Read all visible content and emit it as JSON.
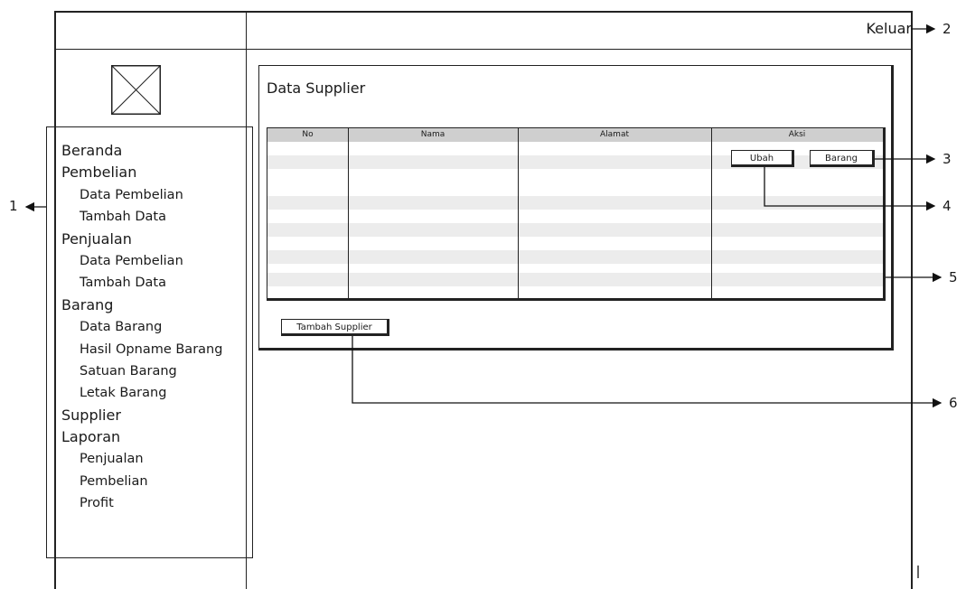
{
  "header": {
    "logout_label": "Keluar"
  },
  "sidebar": {
    "logo_icon": "image-placeholder-icon",
    "items": [
      {
        "label": "Beranda",
        "level": "top"
      },
      {
        "label": "Pembelian",
        "level": "top"
      },
      {
        "label": "Data Pembelian",
        "level": "sub"
      },
      {
        "label": "Tambah Data",
        "level": "sub"
      },
      {
        "label": "Penjualan",
        "level": "top"
      },
      {
        "label": "Data Pembelian",
        "level": "sub"
      },
      {
        "label": "Tambah Data",
        "level": "sub"
      },
      {
        "label": "Barang",
        "level": "top"
      },
      {
        "label": "Data Barang",
        "level": "sub"
      },
      {
        "label": "Hasil Opname Barang",
        "level": "sub"
      },
      {
        "label": "Satuan Barang",
        "level": "sub"
      },
      {
        "label": "Letak Barang",
        "level": "sub"
      },
      {
        "label": "Supplier",
        "level": "top"
      },
      {
        "label": "Laporan",
        "level": "top"
      },
      {
        "label": "Penjualan",
        "level": "sub"
      },
      {
        "label": "Pembelian",
        "level": "sub"
      },
      {
        "label": "Profit",
        "level": "sub"
      }
    ]
  },
  "main": {
    "title": "Data Supplier",
    "table": {
      "columns": [
        "No",
        "Nama",
        "Alamat",
        "Aksi"
      ],
      "row_actions": {
        "edit_label": "Ubah",
        "items_label": "Barang"
      }
    },
    "add_button_label": "Tambah Supplier"
  },
  "callouts": [
    "1",
    "2",
    "3",
    "4",
    "5",
    "6"
  ]
}
